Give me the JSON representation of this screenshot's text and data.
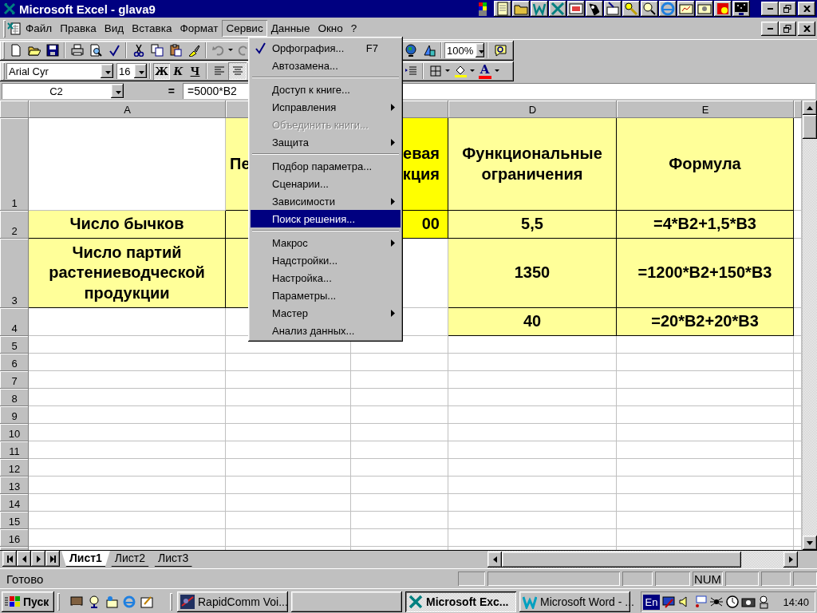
{
  "window": {
    "title": "Microsoft Excel - glava9"
  },
  "menu_bar": [
    {
      "label": "Файл",
      "selected": false
    },
    {
      "label": "Правка",
      "selected": false
    },
    {
      "label": "Вид",
      "selected": false
    },
    {
      "label": "Вставка",
      "selected": false
    },
    {
      "label": "Формат",
      "selected": false
    },
    {
      "label": "Сервис",
      "selected": true
    },
    {
      "label": "Данные",
      "selected": false
    },
    {
      "label": "Окно",
      "selected": false
    },
    {
      "label": "?",
      "selected": false
    }
  ],
  "menu": [
    {
      "kind": "item",
      "label": "Орфография...",
      "shortcut": "F7",
      "icon": true,
      "submenu": false,
      "disabled": false,
      "selected": false
    },
    {
      "kind": "item",
      "label": "Автозамена...",
      "submenu": false,
      "disabled": false,
      "selected": false
    },
    {
      "kind": "separator"
    },
    {
      "kind": "item",
      "label": "Доступ к книге...",
      "submenu": false,
      "disabled": false,
      "selected": false
    },
    {
      "kind": "item",
      "label": "Исправления",
      "submenu": true,
      "disabled": false,
      "selected": false
    },
    {
      "kind": "item",
      "label": "Объединить книги...",
      "submenu": false,
      "disabled": true,
      "selected": false
    },
    {
      "kind": "item",
      "label": "Защита",
      "submenu": true,
      "disabled": false,
      "selected": false
    },
    {
      "kind": "separator"
    },
    {
      "kind": "item",
      "label": "Подбор параметра...",
      "submenu": false,
      "disabled": false,
      "selected": false
    },
    {
      "kind": "item",
      "label": "Сценарии...",
      "submenu": false,
      "disabled": false,
      "selected": false
    },
    {
      "kind": "item",
      "label": "Зависимости",
      "submenu": true,
      "disabled": false,
      "selected": false
    },
    {
      "kind": "item",
      "label": "Поиск решения...",
      "submenu": false,
      "disabled": false,
      "selected": true
    },
    {
      "kind": "separator"
    },
    {
      "kind": "item",
      "label": "Макрос",
      "submenu": true,
      "disabled": false,
      "selected": false
    },
    {
      "kind": "item",
      "label": "Надстройки...",
      "submenu": false,
      "disabled": false,
      "selected": false
    },
    {
      "kind": "item",
      "label": "Настройка...",
      "submenu": false,
      "disabled": false,
      "selected": false
    },
    {
      "kind": "item",
      "label": "Параметры...",
      "submenu": false,
      "disabled": false,
      "selected": false
    },
    {
      "kind": "item",
      "label": "Мастер",
      "submenu": true,
      "disabled": false,
      "selected": false
    },
    {
      "kind": "item",
      "label": "Анализ данных...",
      "submenu": false,
      "disabled": false,
      "selected": false
    }
  ],
  "toolbar": {
    "zoom": "100%"
  },
  "format_bar": {
    "font": "Arial Cyr",
    "size": "16",
    "style_buttons": [
      {
        "label": "Ж",
        "selected": true
      },
      {
        "label": "К",
        "selected": false
      },
      {
        "label": "Ч",
        "selected": false
      }
    ],
    "align_buttons": [
      {
        "selected": false
      },
      {
        "selected": true
      }
    ],
    "font_color_glyph": "A"
  },
  "formula_bar": {
    "name_box": "C2",
    "equals": "=",
    "formula": "=5000*B2"
  },
  "sheet": {
    "columns": [
      {
        "label": "A"
      },
      {},
      {},
      {
        "label": "D"
      },
      {
        "label": "E"
      }
    ],
    "rows": [
      {
        "number": "1",
        "cells": [
          {},
          {
            "text": "Пе",
            "color": "#ffff99"
          },
          {
            "text": "евая\nкция",
            "color": "#ffff00"
          },
          {
            "text": "Функциональные ограничения",
            "color": "#ffff99"
          },
          {
            "text": "Формула",
            "color": "#ffff99"
          }
        ]
      },
      {
        "number": "2",
        "cells": [
          {
            "text": "Число бычков",
            "color": "#ffff99"
          },
          {
            "color": "#ffff99"
          },
          {
            "text": "00",
            "color": "#ffff00"
          },
          {
            "text": "5,5",
            "color": "#ffff99"
          },
          {
            "text": "=4*B2+1,5*B3",
            "color": "#ffff99"
          }
        ]
      },
      {
        "number": "3",
        "cells": [
          {
            "text": "Число партий растениеводческой продукции",
            "color": "#ffff99"
          },
          {
            "color": "#ffff99"
          },
          {},
          {
            "text": "1350",
            "color": "#ffff99"
          },
          {
            "text": "=1200*B2+150*B3",
            "color": "#ffff99"
          }
        ]
      },
      {
        "number": "4",
        "cells": [
          {},
          {},
          {},
          {
            "text": "40",
            "color": "#ffff99"
          },
          {
            "text": "=20*B2+20*B3",
            "color": "#ffff99"
          }
        ]
      },
      {
        "number": "5"
      },
      {
        "number": "6"
      },
      {
        "number": "7"
      },
      {
        "number": "8"
      },
      {
        "number": "9"
      },
      {
        "number": "10"
      },
      {
        "number": "11"
      },
      {
        "number": "12"
      },
      {
        "number": "13"
      },
      {
        "number": "14"
      },
      {
        "number": "15"
      },
      {
        "number": "16"
      }
    ]
  },
  "sheet_tabs": [
    {
      "label": "Лист1",
      "selected": true
    },
    {
      "label": "Лист2",
      "selected": false
    },
    {
      "label": "Лист3",
      "selected": false
    }
  ],
  "status_bar": {
    "text": "Готово",
    "indicators": [
      "NUM"
    ]
  },
  "taskbar": {
    "start": "Пуск",
    "tasks": [
      {
        "kind": "app",
        "label": "RapidComm Voi...",
        "selected": false
      },
      {
        "kind": "blank",
        "selected": false
      },
      {
        "kind": "app",
        "label": "Microsoft Exc...",
        "selected": true
      },
      {
        "kind": "app",
        "label": "Microsoft Word - ...",
        "selected": false
      }
    ],
    "language": "En",
    "clock": "14:40"
  }
}
